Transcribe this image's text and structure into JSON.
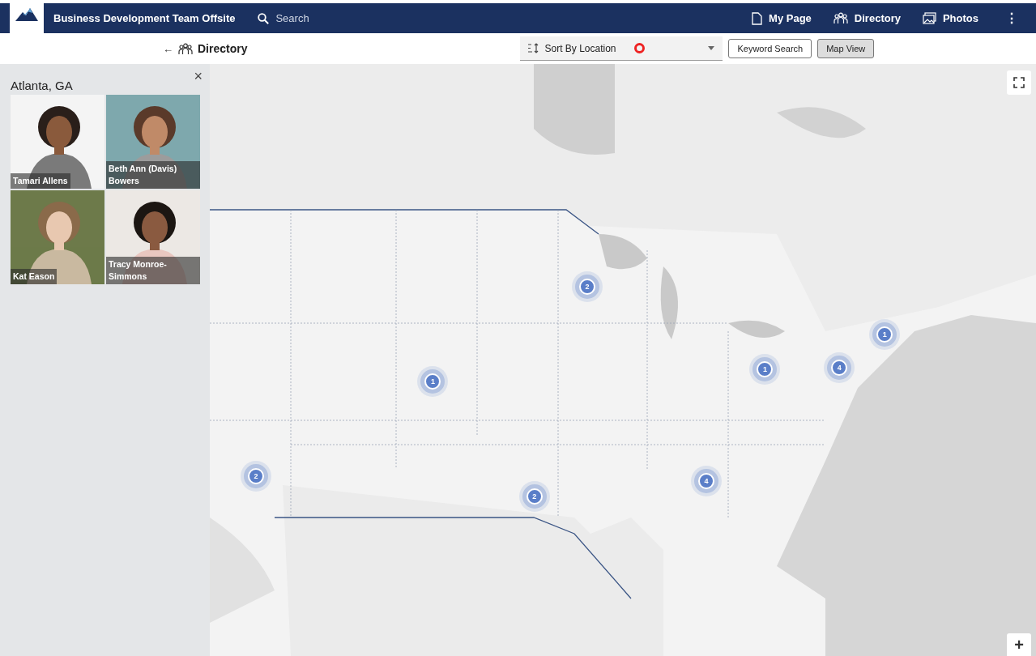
{
  "header": {
    "title": "Business Development Team Offsite",
    "search": {
      "placeholder": "Search"
    },
    "nav": [
      {
        "label": "My Page"
      },
      {
        "label": "Directory"
      },
      {
        "label": "Photos"
      }
    ],
    "more": "⋮"
  },
  "toolbar": {
    "back": "←",
    "title": "Directory",
    "sort": {
      "value": "Sort By Location"
    },
    "buttons": [
      {
        "label": "Keyword Search",
        "selected": false
      },
      {
        "label": "Map View",
        "selected": true
      }
    ]
  },
  "panel": {
    "title": "Atlanta, GA",
    "close": "×",
    "people": [
      {
        "name": "Tamari Allens"
      },
      {
        "name": "Beth Ann (Davis) Bowers"
      },
      {
        "name": "Kat Eason"
      },
      {
        "name": "Tracy Monroe-Simmons"
      }
    ]
  },
  "map": {
    "kind": "picture",
    "clusters": [
      {
        "count": "2"
      },
      {
        "count": "1"
      },
      {
        "count": "2"
      },
      {
        "count": "2"
      },
      {
        "count": "4"
      },
      {
        "count": "1"
      },
      {
        "count": "4"
      },
      {
        "count": "1"
      }
    ],
    "zoom_in": "+"
  }
}
